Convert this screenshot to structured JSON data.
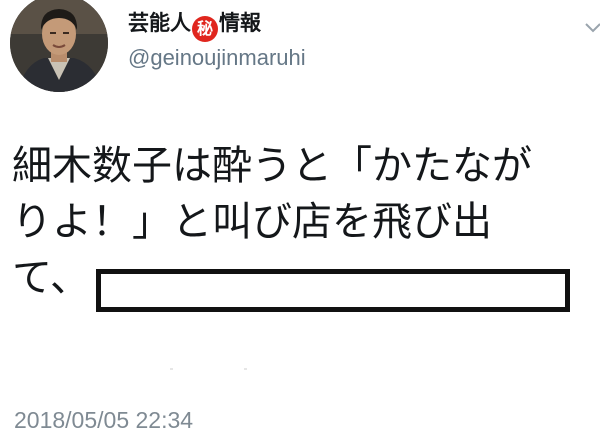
{
  "header": {
    "display_name_part1": "芸能人",
    "display_name_badge": "秘",
    "display_name_part2": "情報",
    "handle": "@geinoujinmaruhi",
    "avatar_icon": "profile-photo",
    "menu_icon": "chevron-down-icon"
  },
  "tweet": {
    "line1": "細木数子は酔うと「かたなが",
    "line2": "りよ！」と叫び店を飛び出",
    "line3": "て、",
    "timestamp": "2018/05/05 22:34"
  },
  "colors": {
    "badge": "#e0261e",
    "handle": "#657786",
    "timestamp": "#7f8a93",
    "text": "#14171a"
  }
}
